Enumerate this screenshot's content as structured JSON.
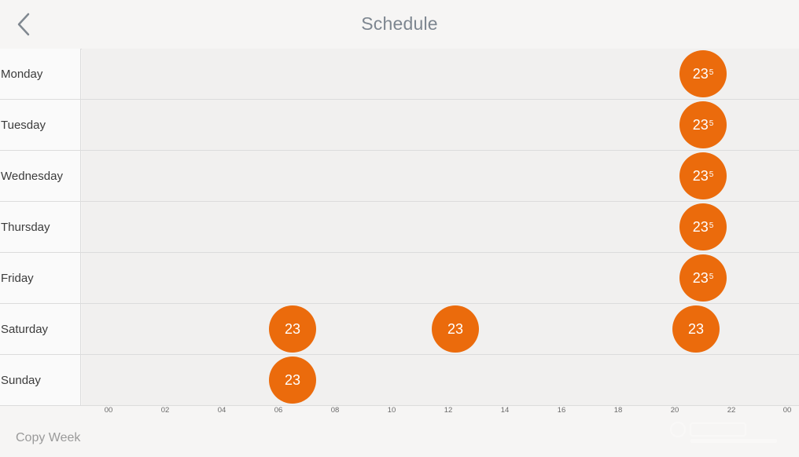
{
  "header": {
    "title": "Schedule",
    "back_icon": "chevron-left-icon"
  },
  "days": [
    {
      "label": "Monday",
      "setpoints": [
        {
          "hour": 21.0,
          "temp": "23",
          "decimal": "5"
        }
      ]
    },
    {
      "label": "Tuesday",
      "setpoints": [
        {
          "hour": 21.0,
          "temp": "23",
          "decimal": "5"
        }
      ]
    },
    {
      "label": "Wednesday",
      "setpoints": [
        {
          "hour": 21.0,
          "temp": "23",
          "decimal": "5"
        }
      ]
    },
    {
      "label": "Thursday",
      "setpoints": [
        {
          "hour": 21.0,
          "temp": "23",
          "decimal": "5"
        }
      ]
    },
    {
      "label": "Friday",
      "setpoints": [
        {
          "hour": 21.0,
          "temp": "23",
          "decimal": "5"
        }
      ]
    },
    {
      "label": "Saturday",
      "setpoints": [
        {
          "hour": 6.5,
          "temp": "23",
          "decimal": ""
        },
        {
          "hour": 12.25,
          "temp": "23",
          "decimal": ""
        },
        {
          "hour": 20.75,
          "temp": "23",
          "decimal": ""
        }
      ]
    },
    {
      "label": "Sunday",
      "setpoints": [
        {
          "hour": 6.5,
          "temp": "23",
          "decimal": ""
        }
      ]
    }
  ],
  "time_axis": [
    "00",
    "02",
    "04",
    "06",
    "08",
    "10",
    "12",
    "14",
    "16",
    "18",
    "20",
    "22",
    "00"
  ],
  "footer": {
    "copy_week_label": "Copy Week"
  },
  "colors": {
    "setpoint": "#eb6b0c",
    "title": "#7d8690",
    "background": "#f6f5f4"
  }
}
